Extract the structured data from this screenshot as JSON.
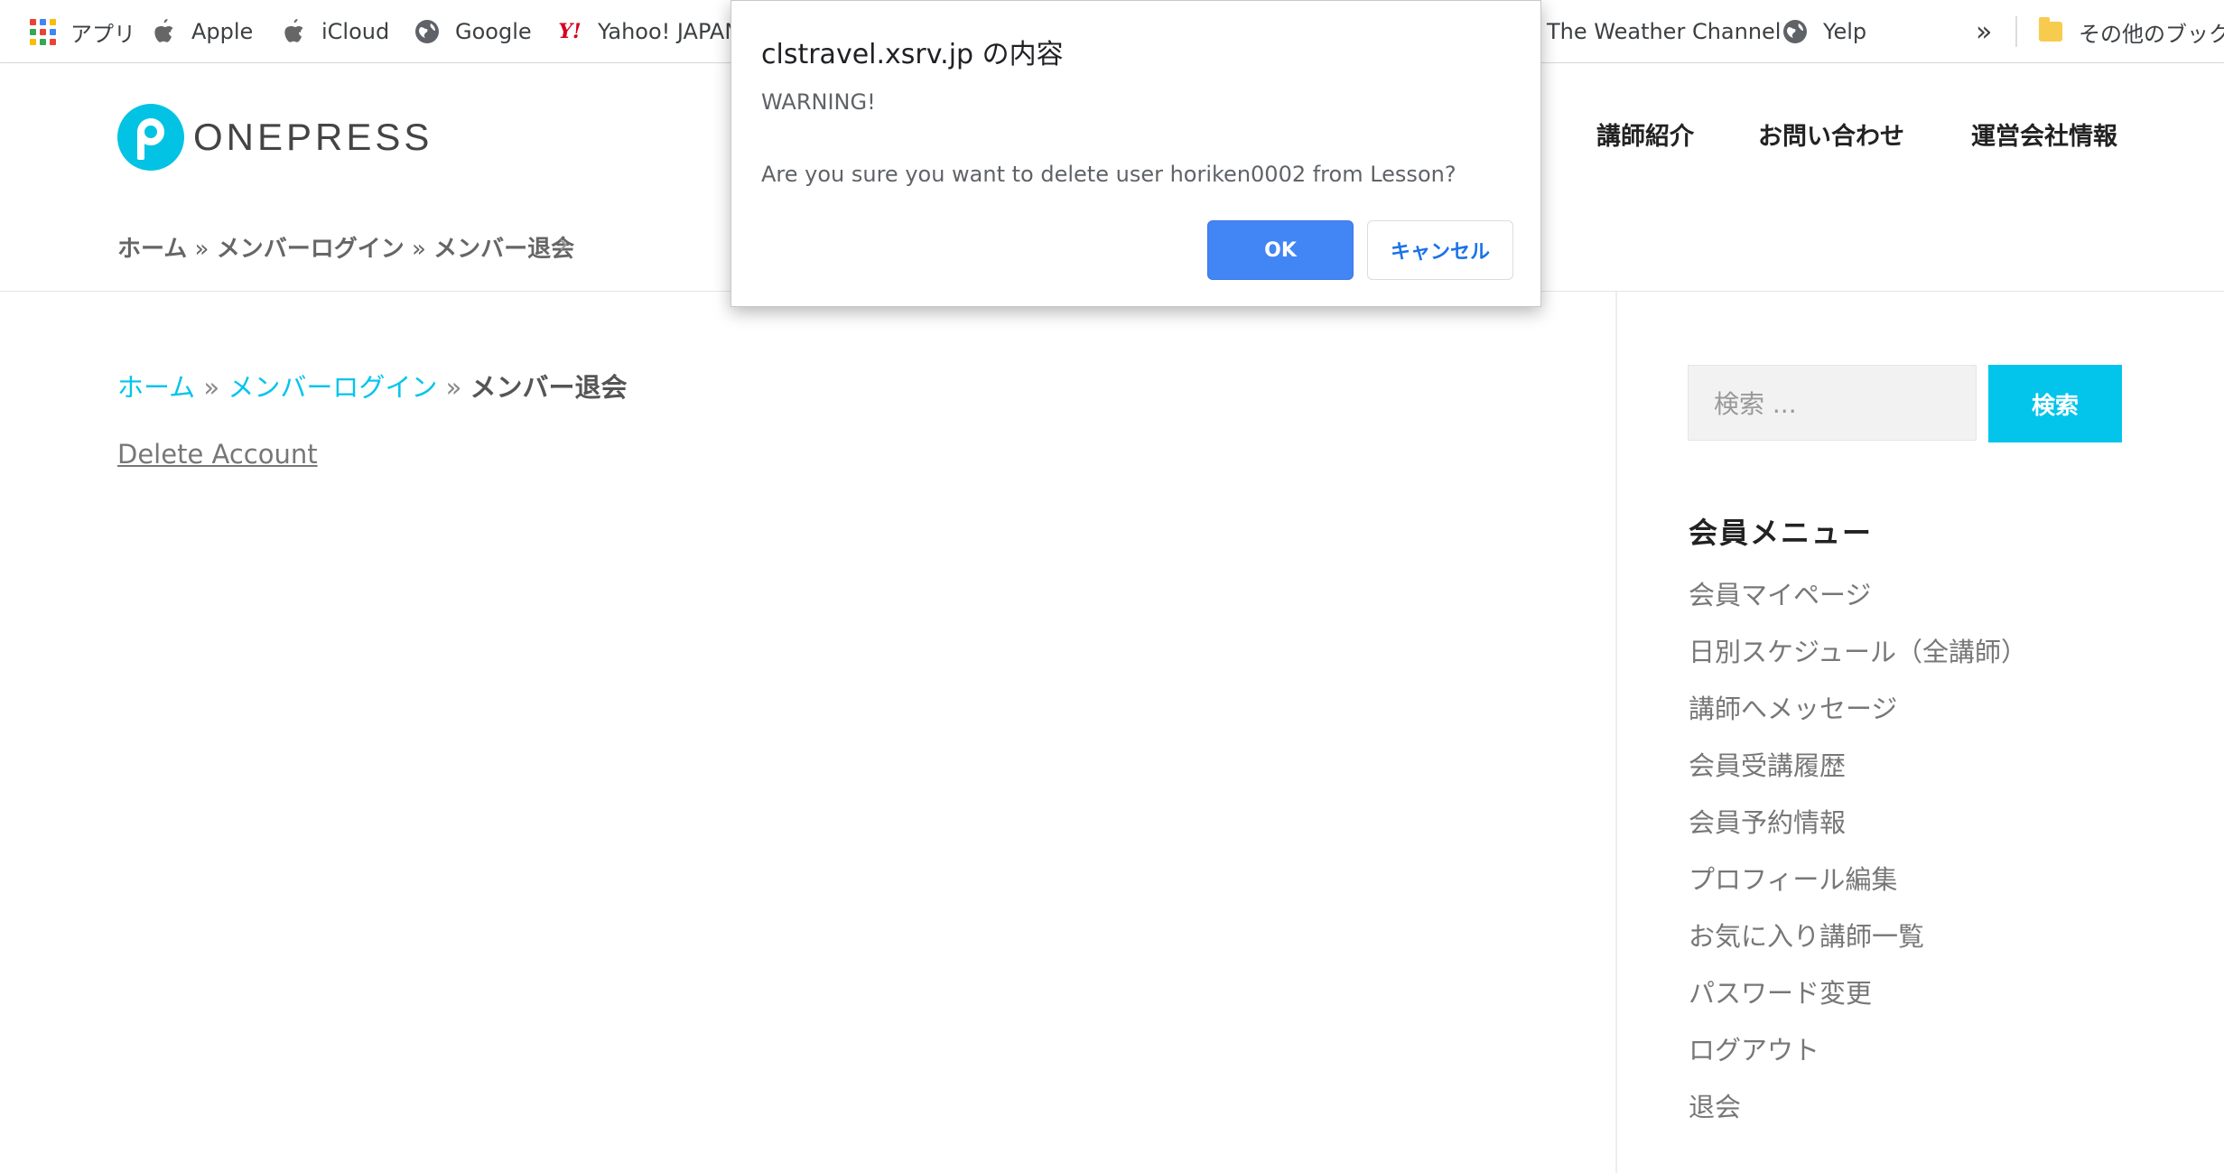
{
  "bookmarks": {
    "items": [
      {
        "label": "アプリ",
        "icon": "apps-grid-icon"
      },
      {
        "label": "Apple",
        "icon": "apple-icon"
      },
      {
        "label": "iCloud",
        "icon": "apple-icon"
      },
      {
        "label": "Google",
        "icon": "globe-icon"
      },
      {
        "label": "Yahoo! JAPAN",
        "icon": "yahoo-icon"
      },
      {
        "label": "The Weather Channel",
        "icon": null
      },
      {
        "label": "Yelp",
        "icon": "globe-icon"
      }
    ],
    "more": "»",
    "other_folder": "その他のブックマー"
  },
  "header": {
    "logo_text": "ONEPRESS",
    "nav": [
      "講師紹介",
      "お問い合わせ",
      "運営会社情報"
    ]
  },
  "top_breadcrumb": {
    "home": "ホーム",
    "sep": "»",
    "login": "メンバーログイン",
    "current": "メンバー退会",
    "chevron": "›"
  },
  "content": {
    "breadcrumb": {
      "home": "ホーム",
      "sep": "»",
      "login": "メンバーログイン",
      "current": "メンバー退会"
    },
    "delete_link": "Delete Account"
  },
  "sidebar": {
    "search_placeholder": "検索 ...",
    "search_button": "検索",
    "menu_title": "会員メニュー",
    "menu_items": [
      "会員マイページ",
      "日別スケジュール（全講師）",
      "講師へメッセージ",
      "会員受講履歴",
      "会員予約情報",
      "プロフィール編集",
      "お気に入り講師一覧",
      "パスワード変更",
      "ログアウト",
      "退会"
    ]
  },
  "dialog": {
    "title": "clstravel.xsrv.jp の内容",
    "warning": "WARNING!",
    "message": "Are you sure you want to delete user horiken0002 from Lesson?",
    "ok": "OK",
    "cancel": "キャンセル"
  },
  "colors": {
    "accent": "#03c4eb",
    "ok_button": "#4285f4",
    "yahoo": "#d60021"
  }
}
